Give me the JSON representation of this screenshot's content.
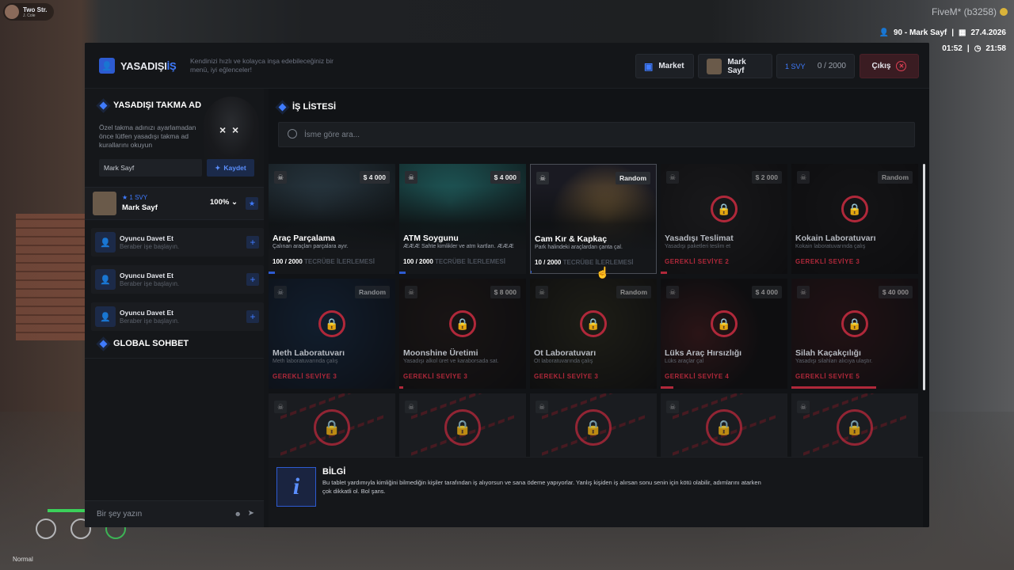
{
  "hud": {
    "player_tag": "Two Str.",
    "player_sub": "J. Cole",
    "server": "FiveM* (b3258)",
    "id_name": "90 - Mark Sayf",
    "date": "27.4.2026",
    "time1": "01:52",
    "time2": "21:58",
    "mode": "Normal"
  },
  "header": {
    "logo_main": "YASADIŞI",
    "logo_accent": "İŞ",
    "tagline": "Kendinizi hızlı ve kolayca inşa edebileceğiniz bir menü, iyi eğlenceler!",
    "market": "Market",
    "profile_name": "Mark Sayf",
    "level": "1 SVY",
    "xp": "0 / 2000",
    "exit": "Çıkış"
  },
  "nick": {
    "title": "YASADIŞI TAKMA AD",
    "desc": "Özel takma adınızı ayarlamadan önce lütfen yasadışı takma ad kurallarını okuyun",
    "value": "Mark Sayf",
    "save": "Kaydet"
  },
  "member": {
    "level": "★ 1 SVY",
    "name": "Mark Sayf",
    "percent": "100%"
  },
  "invites": [
    {
      "title": "Oyuncu Davet Et",
      "sub": "Beraber işe başlayın."
    },
    {
      "title": "Oyuncu Davet Et",
      "sub": "Beraber işe başlayın."
    },
    {
      "title": "Oyuncu Davet Et",
      "sub": "Beraber işe başlayın."
    }
  ],
  "global_chat": "GLOBAL SOHBET",
  "chat_placeholder": "Bir şey yazın",
  "jobs_title": "İŞ LİSTESİ",
  "search_placeholder": "İsme göre ara...",
  "cards": [
    {
      "name": "Araç Parçalama",
      "desc": "Çalınan araçları parçalara ayır.",
      "price": "$ 4 000",
      "xp": "100 / 2000",
      "xp_label": "TECRÜBE İLERLEMESİ",
      "progress": 0.05
    },
    {
      "name": "ATM Soygunu",
      "desc": "ÆÆÆ Sahte kimlikler ve atm kartları. ÆÆÆ",
      "price": "$ 4 000",
      "xp": "100 / 2000",
      "xp_label": "TECRÜBE İLERLEMESİ",
      "progress": 0.05
    },
    {
      "name": "Cam Kır & Kapkaç",
      "desc": "Park halindeki araçlardan çanta çal.",
      "price": "Random",
      "xp": "10 / 2000",
      "xp_label": "TECRÜBE İLERLEMESİ",
      "progress": 0.005
    },
    {
      "name": "Yasadışı Teslimat",
      "desc": "Yasadışı paketleri teslim et",
      "price": "$ 2 000",
      "req": "GEREKLİ SEVİYE 2",
      "progress": 0.05
    },
    {
      "name": "Kokain Laboratuvarı",
      "desc": "Kokain laboratuvarında çalış",
      "price": "Random",
      "req": "GEREKLİ SEVİYE 3",
      "progress": 0
    },
    {
      "name": "Meth Laboratuvarı",
      "desc": "Meth laboratuvarında çalış",
      "price": "Random",
      "req": "GEREKLİ SEVİYE 3",
      "progress": 0
    },
    {
      "name": "Moonshine Üretimi",
      "desc": "Yasadışı alkol üret ve karaborsada sat.",
      "price": "$ 8 000",
      "req": "GEREKLİ SEVİYE 3",
      "progress": 0.03
    },
    {
      "name": "Ot Laboratuvarı",
      "desc": "Ot laboratuvarında çalış",
      "price": "Random",
      "req": "GEREKLİ SEVİYE 3",
      "progress": 0
    },
    {
      "name": "Lüks Araç Hırsızlığı",
      "desc": "Lüks araçlar çal",
      "price": "$ 4 000",
      "req": "GEREKLİ SEVİYE 4",
      "progress": 0.1
    },
    {
      "name": "Silah Kaçakçılığı",
      "desc": "Yasadışı silahları alıcıya ulaştır.",
      "price": "$ 40 000",
      "req": "GEREKLİ SEVİYE 5",
      "progress": 0.67
    }
  ],
  "info": {
    "title": "BİLGİ",
    "text": "Bu tablet yardımıyla kimliğini bilmediğin kişiler tarafından iş alıyorsun ve sana ödeme yapıyorlar. Yanlış kişiden iş alırsan sonu senin için kötü olabilir, adımlarını atarken çok dikkatli ol. Bol şans.",
    "icon": "i"
  },
  "colors": {
    "accent": "#3f7bff",
    "danger": "#b0283a"
  }
}
